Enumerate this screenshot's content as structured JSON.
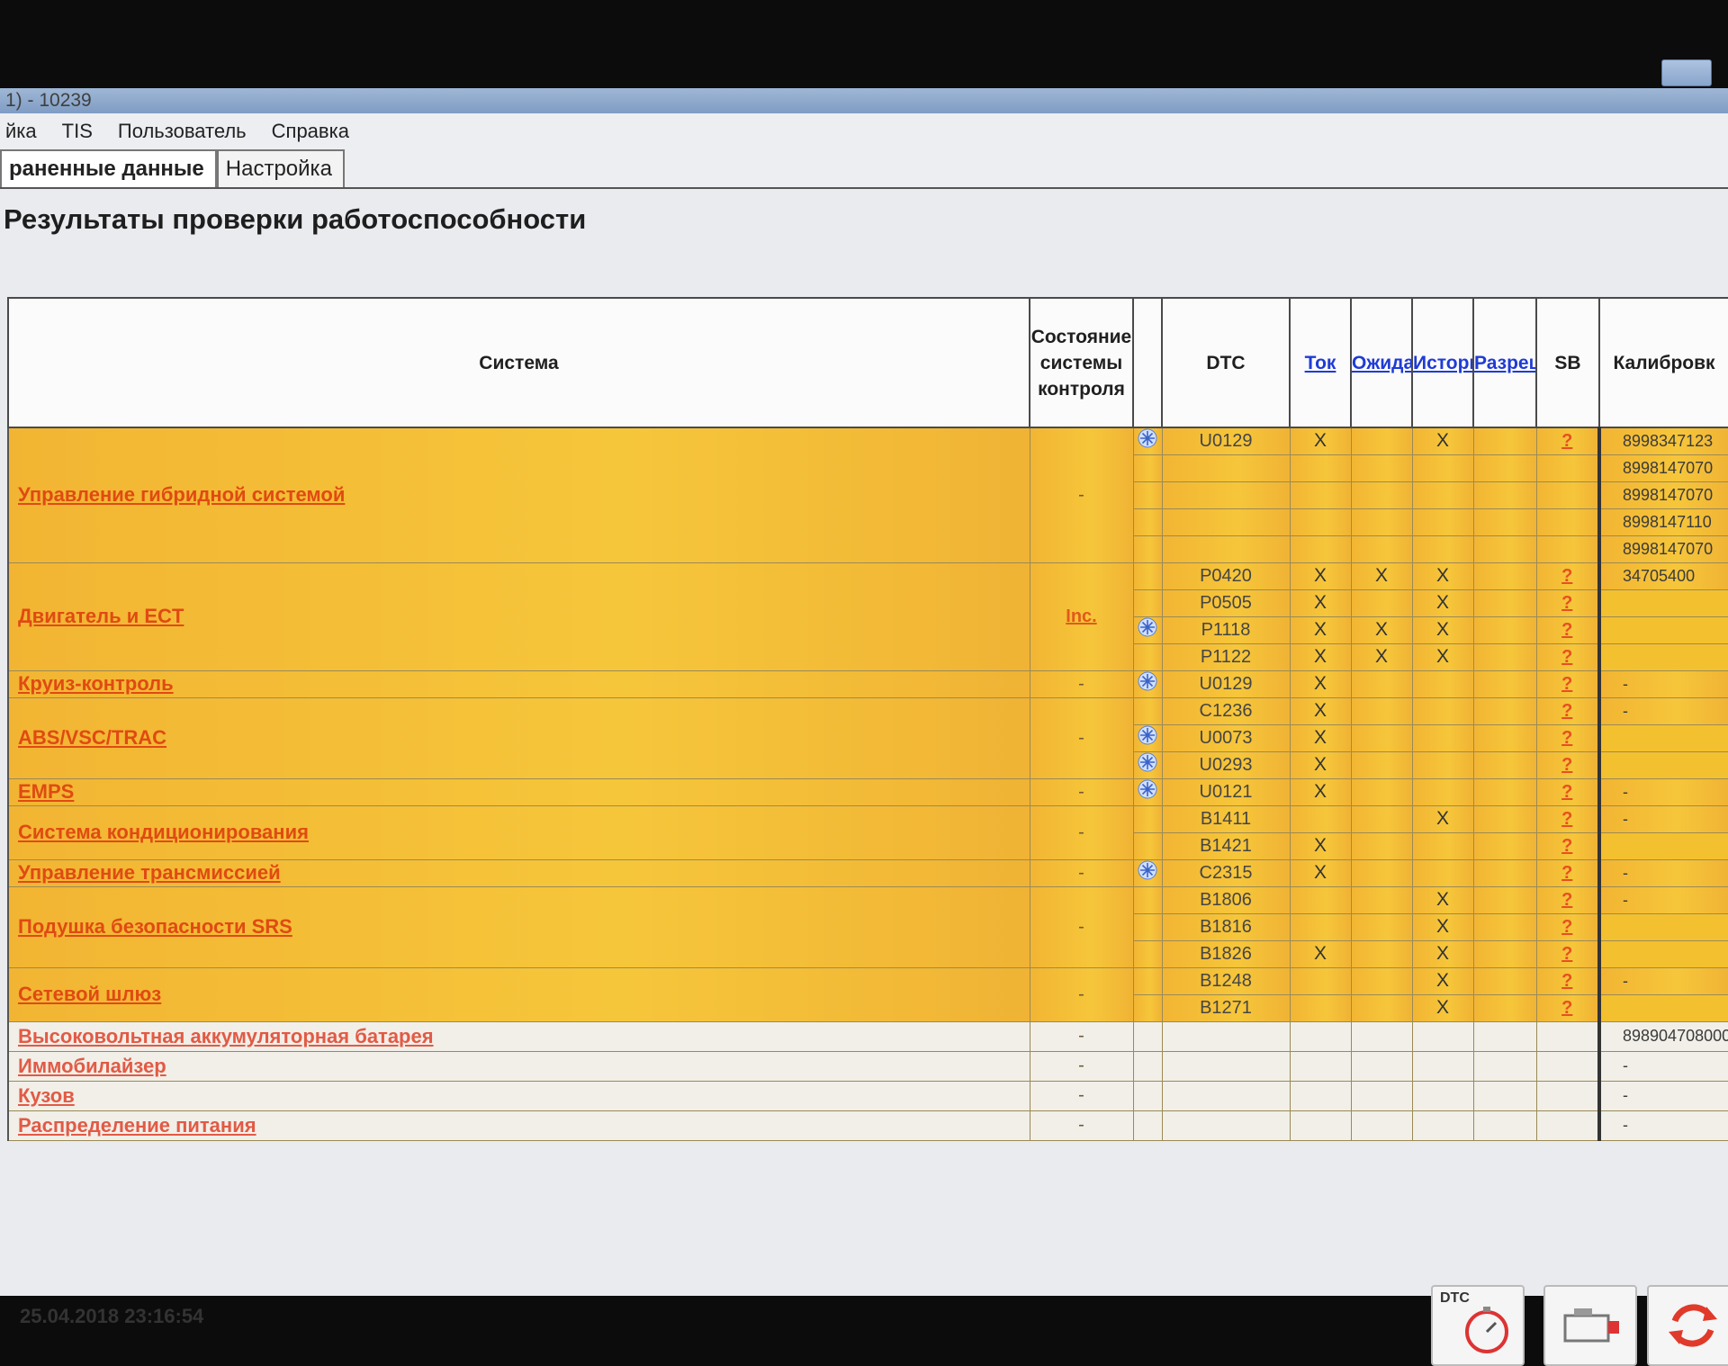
{
  "window": {
    "title": "1) - 10239"
  },
  "menu": [
    "йка",
    "TIS",
    "Пользователь",
    "Справка"
  ],
  "tabs": [
    {
      "label": "раненные данные",
      "active": true
    },
    {
      "label": "Настройка",
      "active": false
    }
  ],
  "page_title": "Результаты проверки работоспособности",
  "columns": {
    "system": "Система",
    "status": "Состояние системы контроля",
    "dtc": "DTC",
    "current": "Ток",
    "pending": "Ожидание",
    "history": "История",
    "permission": "Разрешения",
    "sb": "SB",
    "calibration": "Калибровк"
  },
  "rows": [
    {
      "system": "Управление гибридной системой",
      "span": 5,
      "status": "-",
      "freeze": true,
      "dtc": "U0129",
      "current": "X",
      "pending": "",
      "history": "X",
      "sb": "?",
      "cal": "8998347123"
    },
    {
      "dtc": "",
      "cal": "8998147070"
    },
    {
      "dtc": "",
      "cal": "8998147070"
    },
    {
      "dtc": "",
      "cal": "8998147110"
    },
    {
      "dtc": "",
      "cal": "8998147070"
    },
    {
      "system": "Двигатель и ECT",
      "span": 4,
      "status": "Inc.",
      "freeze": false,
      "dtc": "P0420",
      "current": "X",
      "pending": "X",
      "history": "X",
      "sb": "?",
      "cal": "34705400"
    },
    {
      "freeze": false,
      "dtc": "P0505",
      "current": "X",
      "pending": "",
      "history": "X",
      "sb": "?",
      "cal": ""
    },
    {
      "freeze": true,
      "dtc": "P1118",
      "current": "X",
      "pending": "X",
      "history": "X",
      "sb": "?",
      "cal": ""
    },
    {
      "freeze": false,
      "dtc": "P1122",
      "current": "X",
      "pending": "X",
      "history": "X",
      "sb": "?",
      "cal": ""
    },
    {
      "system": "Круиз-контроль",
      "span": 1,
      "status": "-",
      "freeze": true,
      "dtc": "U0129",
      "current": "X",
      "pending": "",
      "history": "",
      "sb": "?",
      "cal": "-"
    },
    {
      "system": "ABS/VSC/TRAC",
      "span": 3,
      "status": "-",
      "freeze": false,
      "dtc": "C1236",
      "current": "X",
      "pending": "",
      "history": "",
      "sb": "?",
      "cal": "-"
    },
    {
      "freeze": true,
      "dtc": "U0073",
      "current": "X",
      "pending": "",
      "history": "",
      "sb": "?",
      "cal": ""
    },
    {
      "freeze": true,
      "dtc": "U0293",
      "current": "X",
      "pending": "",
      "history": "",
      "sb": "?",
      "cal": ""
    },
    {
      "system": "EMPS",
      "span": 1,
      "status": "-",
      "freeze": true,
      "dtc": "U0121",
      "current": "X",
      "pending": "",
      "history": "",
      "sb": "?",
      "cal": "-"
    },
    {
      "system": "Система кондиционирования",
      "span": 2,
      "status": "-",
      "freeze": false,
      "dtc": "B1411",
      "current": "",
      "pending": "",
      "history": "X",
      "sb": "?",
      "cal": "-"
    },
    {
      "freeze": false,
      "dtc": "B1421",
      "current": "X",
      "pending": "",
      "history": "",
      "sb": "?",
      "cal": ""
    },
    {
      "system": "Управление трансмиссией",
      "span": 1,
      "status": "-",
      "freeze": true,
      "dtc": "C2315",
      "current": "X",
      "pending": "",
      "history": "",
      "sb": "?",
      "cal": "-"
    },
    {
      "system": "Подушка безопасности SRS",
      "span": 3,
      "status": "-",
      "freeze": false,
      "dtc": "B1806",
      "current": "",
      "pending": "",
      "history": "X",
      "sb": "?",
      "cal": "-"
    },
    {
      "freeze": false,
      "dtc": "B1816",
      "current": "",
      "pending": "",
      "history": "X",
      "sb": "?",
      "cal": ""
    },
    {
      "freeze": false,
      "dtc": "B1826",
      "current": "X",
      "pending": "",
      "history": "X",
      "sb": "?",
      "cal": ""
    },
    {
      "system": "Сетевой шлюз",
      "span": 2,
      "status": "-",
      "freeze": false,
      "dtc": "B1248",
      "current": "",
      "pending": "",
      "history": "X",
      "sb": "?",
      "cal": "-"
    },
    {
      "freeze": false,
      "dtc": "B1271",
      "current": "",
      "pending": "",
      "history": "X",
      "sb": "?",
      "cal": ""
    }
  ],
  "plain_rows": [
    {
      "system": "Высоковольтная аккумуляторная батарея",
      "status": "-",
      "cal": "898904708000"
    },
    {
      "system": "Иммобилайзер",
      "status": "-",
      "cal": "-"
    },
    {
      "system": "Кузов",
      "status": "-",
      "cal": "-"
    },
    {
      "system": "Распределение питания",
      "status": "-",
      "cal": "-"
    }
  ],
  "footer": {
    "datetime": "25.04.2018 23:16:54",
    "dtc_button_label": "DTC"
  },
  "colors": {
    "highlight_row": "#f5bf36",
    "system_link": "#e04a12",
    "header_link": "#1f3bd6"
  }
}
